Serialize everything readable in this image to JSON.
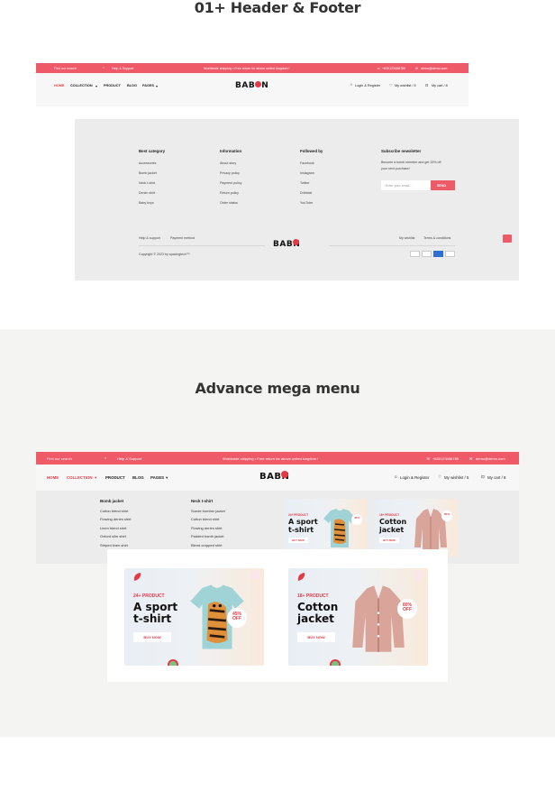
{
  "sections": {
    "header_footer_title": "01+ Header & Footer",
    "mega_menu_title": "Advance mega menu"
  },
  "topbar": {
    "search_placeholder": "Find our search",
    "help": "Help & Support",
    "promo": "Worldwide shipping • Free return for above united kingdom !",
    "phone": "+6301234567​89",
    "email": "demo@demo.com"
  },
  "nav": {
    "home": "HOME",
    "collection": "COLLECTION",
    "product": "PRODUCT",
    "blog": "BLOG",
    "pages": "PAGES",
    "logo_prefix": "BAB",
    "logo_suffix": "N",
    "login": "Login & Register",
    "wishlist": "My wishlist / 5",
    "cart": "My cart / 8"
  },
  "footer": {
    "cols": [
      {
        "title": "Best category",
        "items": [
          "Accessories",
          "Bomb jacket",
          "Neck t-shirt",
          "Denim shirt",
          "Baby boys"
        ]
      },
      {
        "title": "Information",
        "items": [
          "About story",
          "Privacy policy",
          "Payment policy",
          "Return policy",
          "Order status"
        ]
      },
      {
        "title": "Followed by",
        "items": [
          "Facebook",
          "Instagram",
          "Twitter",
          "Dribbble",
          "YouTube"
        ]
      }
    ],
    "newsletter_title": "Subscribe newsletter",
    "newsletter_text_1": "Become a bomb member and get 15% off",
    "newsletter_text_2": "your next purchase!",
    "email_placeholder": "Enter your email...",
    "send": "SEND",
    "help": "Help & support",
    "payment": "Payment method",
    "wishlist": "My wishlist",
    "terms": "Terms & conditions",
    "copyright": "Copyright © 2023 by spacingtech™",
    "payments": [
      "VISA",
      "P",
      "AMEX",
      "MC"
    ]
  },
  "mega": {
    "col1_title": "Bomb jacket",
    "col1_items": [
      "Cotton blend shirt",
      "Flowing denim shirt",
      "Linen blend shirt",
      "Oxford slim shirt",
      "Striped linen shirt"
    ],
    "col2_title": "Neck t-shirt",
    "col2_items": [
      "Suede bomber jacket",
      "Cotton blend shirt",
      "Flowing denim shirt",
      "Padded bomb jacket",
      "Blend cropped shirt"
    ],
    "card1": {
      "tag": "24+ PRODUCT",
      "title1": "A sport",
      "title2": "t-shirt",
      "btn": "BUY NOW",
      "badge1": "45%",
      "badge2": "OFF"
    },
    "card2": {
      "tag": "18+ PRODUCT",
      "title1": "Cotton",
      "title2": "jacket",
      "btn": "BUY NOW",
      "badge1": "80%",
      "badge2": "OFF"
    }
  },
  "colors": {
    "accent": "#ee5a68",
    "logo_red": "#e63946",
    "section_bg": "#f4f4f2"
  }
}
